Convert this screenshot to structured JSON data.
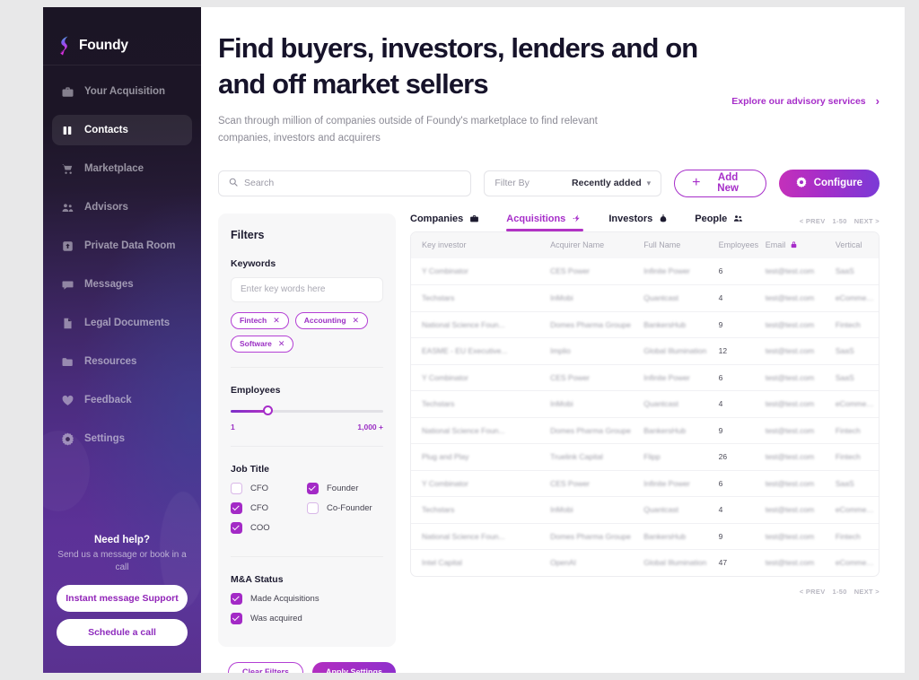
{
  "brand": {
    "name": "Foundy",
    "logo_icon": "foundy-logo-icon"
  },
  "sidebar": {
    "items": [
      {
        "label": "Your Acquisition",
        "icon": "briefcase-icon",
        "active": false
      },
      {
        "label": "Contacts",
        "icon": "contacts-icon",
        "active": true
      },
      {
        "label": "Marketplace",
        "icon": "cart-icon",
        "active": false
      },
      {
        "label": "Advisors",
        "icon": "people-icon",
        "active": false
      },
      {
        "label": "Private Data Room",
        "icon": "upload-box-icon",
        "active": false
      },
      {
        "label": "Messages",
        "icon": "chat-bubble-icon",
        "active": false
      },
      {
        "label": "Legal Documents",
        "icon": "document-icon",
        "active": false
      },
      {
        "label": "Resources",
        "icon": "folder-icon",
        "active": false
      },
      {
        "label": "Feedback",
        "icon": "heart-icon",
        "active": false
      },
      {
        "label": "Settings",
        "icon": "gear-icon",
        "active": false
      }
    ],
    "help": {
      "title": "Need help?",
      "subtitle": "Send us a message or book in a call",
      "primary_button": "Instant message Support",
      "secondary_button": "Schedule a call"
    }
  },
  "header": {
    "title": "Find buyers, investors, lenders and on and off market sellers",
    "subtitle": "Scan through million of companies outside of Foundy's marketplace to find relevant companies, investors and acquirers",
    "advisory_link": "Explore our advisory services",
    "advisory_chevron": "›"
  },
  "toolbar": {
    "search_placeholder": "Search",
    "search_value": "",
    "search_icon": "search-icon",
    "filter_label": "Filter By",
    "filter_value": "Recently added",
    "filter_options": [
      "Recently added"
    ],
    "add_new_label": "Add New",
    "configure_label": "Configure",
    "configure_icon": "gear-icon"
  },
  "filters": {
    "heading": "Filters",
    "keywords_label": "Keywords",
    "keywords_placeholder": "Enter key words here",
    "keywords_value": "",
    "chips": [
      "Fintech",
      "Accounting",
      "Software"
    ],
    "employees_label": "Employees",
    "employees_min": "1",
    "employees_max": "1,000 +",
    "employees_position_pct": 24,
    "job_title_label": "Job Title",
    "job_titles": [
      {
        "label": "CFO",
        "checked": false
      },
      {
        "label": "CFO",
        "checked": true
      },
      {
        "label": "COO",
        "checked": true
      },
      {
        "label": "Founder",
        "checked": true
      },
      {
        "label": "Co-Founder",
        "checked": false
      }
    ],
    "ma_status_label": "M&A Status",
    "ma_status": [
      {
        "label": "Made Acquisitions",
        "checked": true
      },
      {
        "label": "Was acquired",
        "checked": true
      }
    ],
    "clear_label": "Clear Filters",
    "apply_label": "Apply Settings"
  },
  "table": {
    "tabs": [
      {
        "label": "Companies",
        "icon": "briefcase-icon",
        "active": false
      },
      {
        "label": "Acquisitions",
        "icon": "handshake-icon",
        "active": true
      },
      {
        "label": "Investors",
        "icon": "money-bag-icon",
        "active": false
      },
      {
        "label": "People",
        "icon": "people-group-icon",
        "active": false
      }
    ],
    "pagination": {
      "prev": "< PREV",
      "range": "1-50",
      "next": "NEXT >"
    },
    "columns": [
      {
        "label": "Key investor",
        "icon": null
      },
      {
        "label": "Acquirer Name",
        "icon": null
      },
      {
        "label": "Full Name",
        "icon": null
      },
      {
        "label": "Employees",
        "icon": null
      },
      {
        "label": "Email",
        "icon": "lock-icon"
      },
      {
        "label": "Vertical",
        "icon": null
      }
    ],
    "rows": [
      [
        "Y Combinator",
        "CES Power",
        "Infinite Power",
        "6",
        "test@test.com",
        "SaaS"
      ],
      [
        "Techstars",
        "InMobi",
        "Quantcast",
        "4",
        "test@test.com",
        "eCommerce"
      ],
      [
        "National Science Foun...",
        "Domes Pharma Groupe",
        "BankersHub",
        "9",
        "test@test.com",
        "Fintech"
      ],
      [
        "EASME - EU Executive...",
        "Implio",
        "Global Illumination",
        "12",
        "test@test.com",
        "SaaS"
      ],
      [
        "Y Combinator",
        "CES Power",
        "Infinite Power",
        "6",
        "test@test.com",
        "SaaS"
      ],
      [
        "Techstars",
        "InMobi",
        "Quantcast",
        "4",
        "test@test.com",
        "eCommerce"
      ],
      [
        "National Science Foun...",
        "Domes Pharma Groupe",
        "BankersHub",
        "9",
        "test@test.com",
        "Fintech"
      ],
      [
        "Plug and Play",
        "Truelink Capital",
        "Flipp",
        "26",
        "test@test.com",
        "Fintech"
      ],
      [
        "Y Combinator",
        "CES Power",
        "Infinite Power",
        "6",
        "test@test.com",
        "SaaS"
      ],
      [
        "Techstars",
        "InMobi",
        "Quantcast",
        "4",
        "test@test.com",
        "eCommerce"
      ],
      [
        "National Science Foun...",
        "Domes Pharma Groupe",
        "BankersHub",
        "9",
        "test@test.com",
        "Fintech"
      ],
      [
        "Intel Capital",
        "OpenAI",
        "Global Illumination",
        "47",
        "test@test.com",
        "eCommerce"
      ]
    ]
  },
  "colors": {
    "accent": "#a62dc9",
    "accent_dark": "#7b3ad6",
    "sidebar_top": "#1b1525",
    "sidebar_bottom": "#5e3399",
    "title": "#16132a"
  }
}
